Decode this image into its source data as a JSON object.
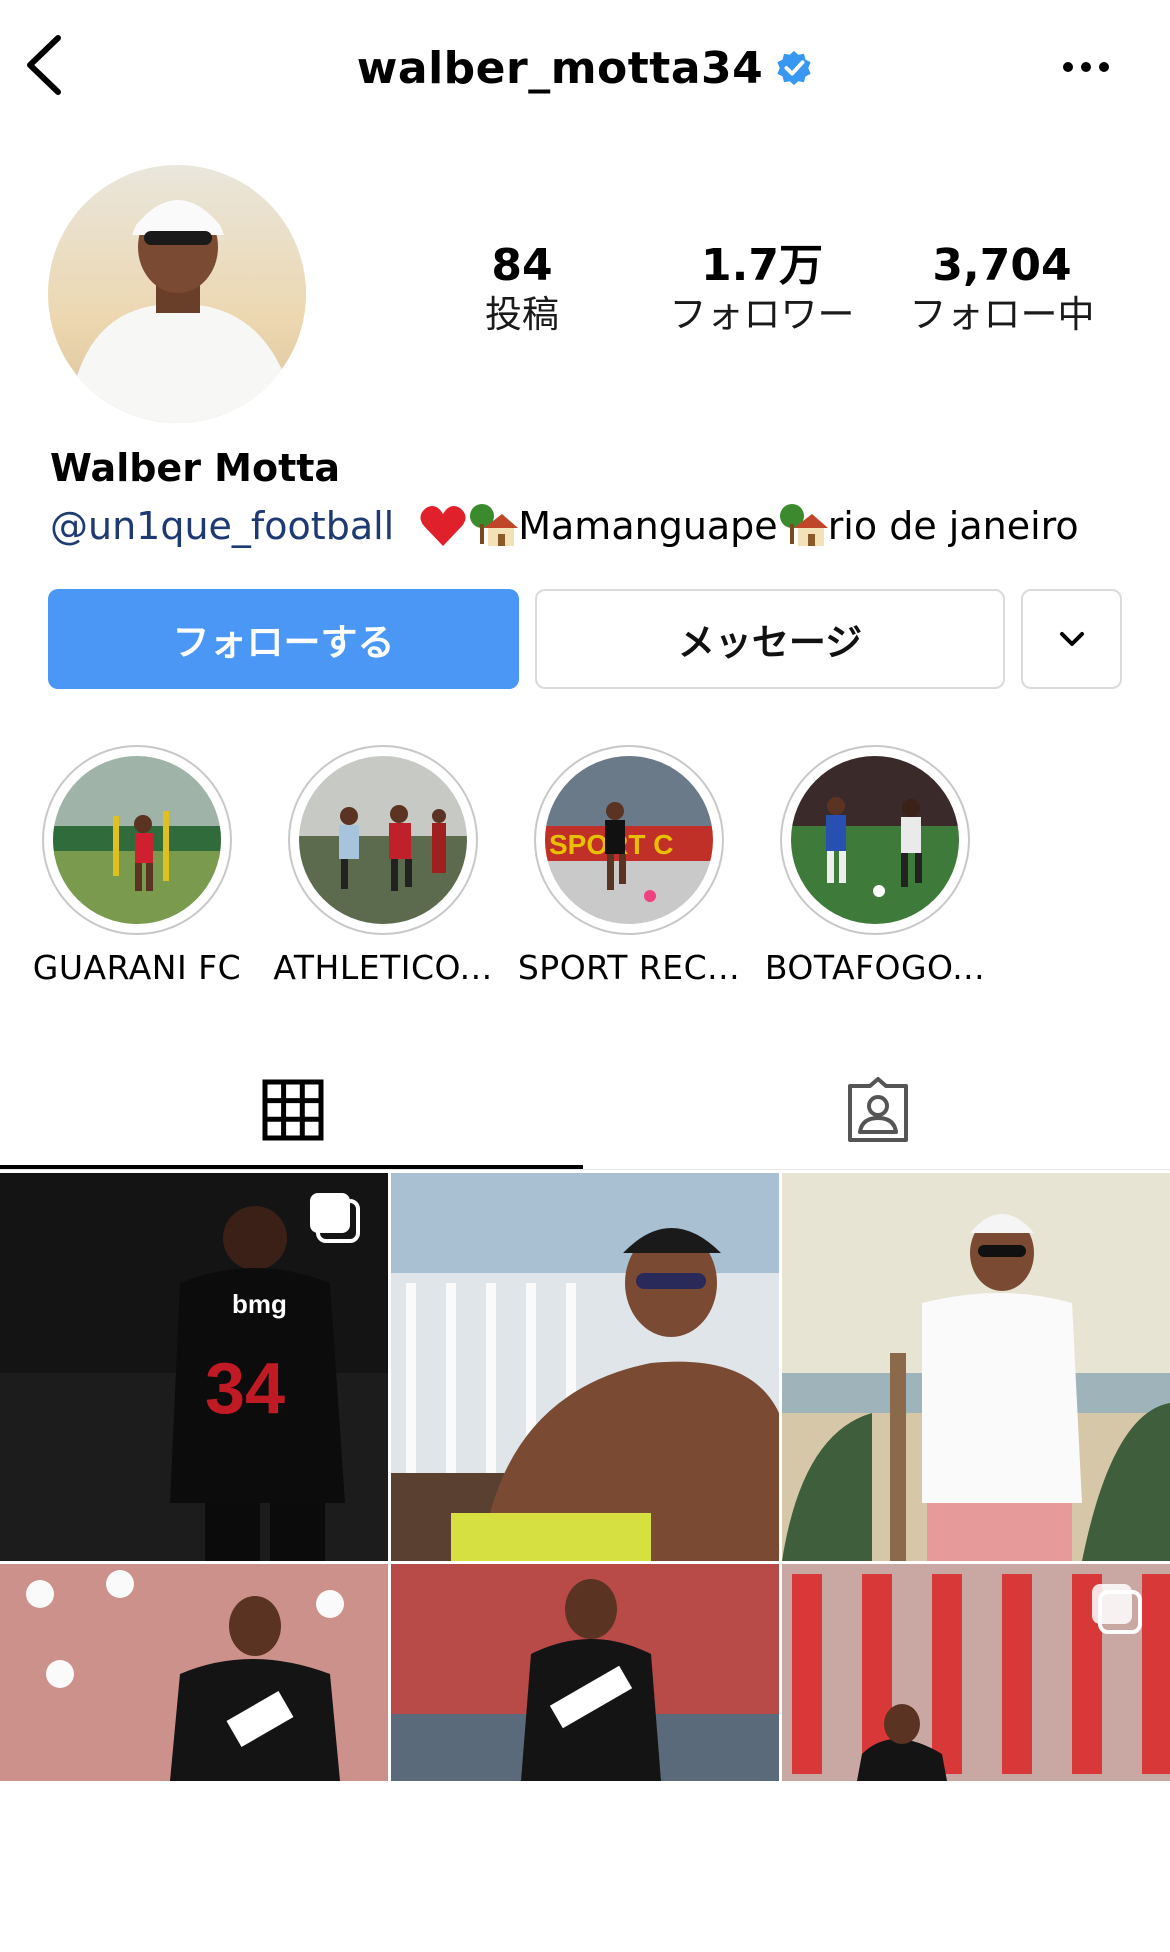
{
  "header": {
    "username": "walber_motta34",
    "verified_icon": "verified-badge-icon",
    "back_icon": "chevron-left-icon",
    "more_icon": "more-horizontal-icon"
  },
  "stats": [
    {
      "value": "84",
      "label": "投稿"
    },
    {
      "value": "1.7万",
      "label": "フォロワー"
    },
    {
      "value": "3,704",
      "label": "フォロー中"
    }
  ],
  "profile": {
    "display_name": "Walber Motta",
    "bio_link": "@un1que_football",
    "bio_text_1": "Mamanguape",
    "bio_text_2": "rio de janeiro"
  },
  "actions": {
    "follow_label": "フォローする",
    "message_label": "メッセージ"
  },
  "highlights": [
    {
      "label": "GUARANI FC"
    },
    {
      "label": "ATHLETICO..."
    },
    {
      "label": "SPORT REC..."
    },
    {
      "label": "BOTAFOGO..."
    }
  ],
  "tabs": [
    {
      "icon": "grid-icon",
      "active": true
    },
    {
      "icon": "tagged-person-icon",
      "active": false
    }
  ],
  "colors": {
    "accent": "#4a97f5",
    "verified": "#3897f0",
    "link": "#1e3a73"
  }
}
